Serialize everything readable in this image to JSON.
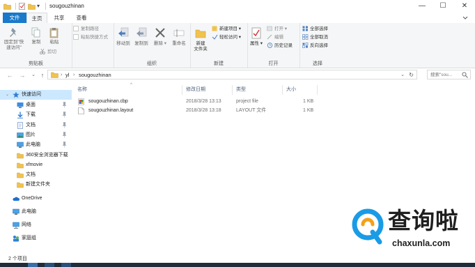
{
  "window": {
    "title": "sougouzhinan",
    "minimize_glyph": "—",
    "maximize_glyph": "☐",
    "close_glyph": "✕"
  },
  "ribbon_tabs": {
    "file": "文件",
    "home": "主页",
    "share": "共享",
    "view": "查看"
  },
  "ribbon": {
    "clipboard": {
      "pin_label_line1": "固定到\"快",
      "pin_label_line2": "速访问\"",
      "copy": "复制",
      "paste": "粘贴",
      "copy_path": "复制路径",
      "paste_shortcut": "粘贴快捷方式",
      "cut": "剪切",
      "group": "剪贴板"
    },
    "organize": {
      "move_to": "移动到",
      "copy_to": "复制到",
      "delete": "删除",
      "rename": "重命名",
      "group": "组织"
    },
    "new": {
      "new_folder_line1": "新建",
      "new_folder_line2": "文件夹",
      "new_item": "新建项目",
      "easy_access": "轻松访问",
      "group": "新建"
    },
    "open": {
      "properties": "属性",
      "open": "打开",
      "edit": "编辑",
      "history": "历史记录",
      "group": "打开"
    },
    "select": {
      "select_all": "全部选择",
      "select_none": "全部取消",
      "invert": "反向选择",
      "group": "选择"
    }
  },
  "address_bar": {
    "back": "←",
    "forward": "→",
    "recent": "⌄",
    "up": "↑",
    "chevron": "›",
    "path": [
      "yl",
      "sougouzhinan"
    ],
    "dropdown": "⌄",
    "refresh": "↻"
  },
  "search": {
    "placeholder": "搜索\"sou..."
  },
  "nav_pane": {
    "quick_access": "快速访问",
    "items": [
      {
        "label": "桌面",
        "icon": "desktop-icon",
        "pinned": true
      },
      {
        "label": "下载",
        "icon": "download-icon",
        "pinned": true
      },
      {
        "label": "文档",
        "icon": "documents-icon",
        "pinned": true
      },
      {
        "label": "图片",
        "icon": "pictures-icon",
        "pinned": true
      },
      {
        "label": "此电脑",
        "icon": "computer-icon",
        "pinned": true
      },
      {
        "label": "360安全浏览器下载",
        "icon": "folder-icon",
        "pinned": false
      },
      {
        "label": "xfmovie",
        "icon": "folder-icon",
        "pinned": false
      },
      {
        "label": "文档",
        "icon": "folder-icon",
        "pinned": false
      },
      {
        "label": "新建文件夹",
        "icon": "folder-icon",
        "pinned": false
      }
    ],
    "onedrive": "OneDrive",
    "this_pc": "此电脑",
    "network": "网络",
    "homegroup": "家庭组"
  },
  "columns": {
    "name": "名称",
    "modified": "修改日期",
    "type": "类型",
    "size": "大小",
    "sort_glyph": "^"
  },
  "files": [
    {
      "name": "sougouzhinan.cbp",
      "modified": "2018/3/28 13:13",
      "type": "project file",
      "size": "1 KB",
      "icon": "project-file-icon"
    },
    {
      "name": "sougouzhinan.layout",
      "modified": "2018/3/28 13:18",
      "type": "LAYOUT 文件",
      "size": "1 KB",
      "icon": "generic-file-icon"
    }
  ],
  "status": {
    "item_count": "2 个项目"
  },
  "watermark": {
    "title": "查询啦",
    "url": "chaxunla.com"
  },
  "colors": {
    "accent": "#1979ca",
    "selection": "#cce8ff",
    "folder": "#f0c34e",
    "watermark_blue": "#1a9be6",
    "watermark_orange": "#f4a11a"
  }
}
